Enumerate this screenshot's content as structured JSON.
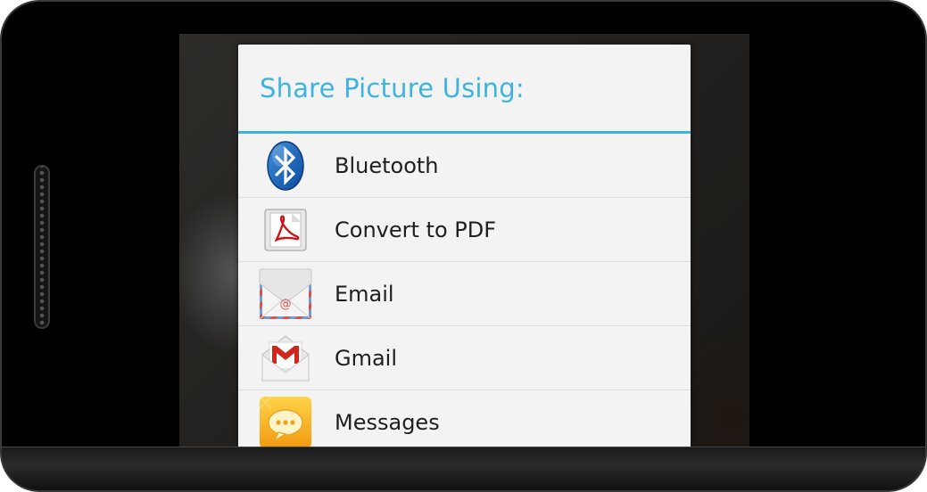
{
  "dialog": {
    "title": "Share Picture Using:",
    "accent_color": "#3fb3e0",
    "options": [
      {
        "label": "Bluetooth",
        "icon": "bluetooth-icon"
      },
      {
        "label": "Convert to PDF",
        "icon": "pdf-icon"
      },
      {
        "label": "Email",
        "icon": "email-icon"
      },
      {
        "label": "Gmail",
        "icon": "gmail-icon"
      },
      {
        "label": "Messages",
        "icon": "messages-icon"
      }
    ]
  }
}
